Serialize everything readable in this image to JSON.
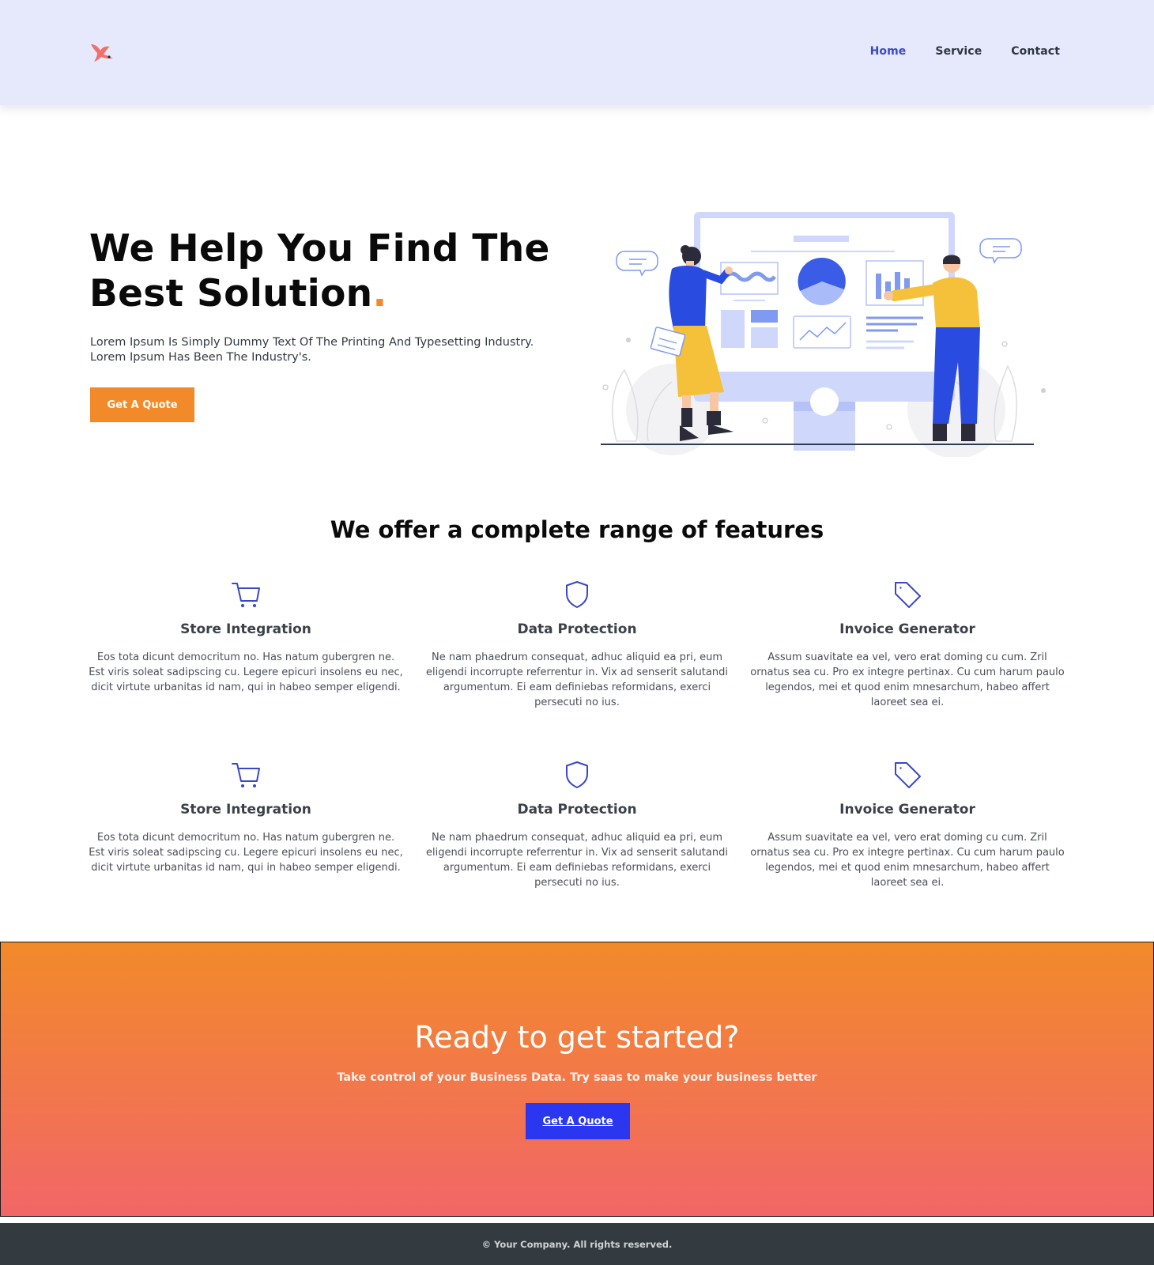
{
  "header": {
    "logo_icon": "bird-logo-icon",
    "nav": [
      {
        "label": "Home",
        "active": true
      },
      {
        "label": "Service",
        "active": false
      },
      {
        "label": "Contact",
        "active": false
      }
    ]
  },
  "hero": {
    "title_line1": "We Help You Find The",
    "title_line2": "Best Solution",
    "title_dot": ".",
    "text_line1": "Lorem Ipsum Is Simply Dummy Text Of The Printing And Typesetting Industry.",
    "text_line2": "Lorem Ipsum Has Been The Industry's.",
    "button_label": "Get A Quote",
    "illustration": "people-analyzing-dashboard-illustration"
  },
  "features": {
    "title": "We offer a complete range of features",
    "items": [
      {
        "icon": "cart-icon",
        "title": "Store Integration",
        "text": "Eos tota dicunt democritum no. Has natum gubergren ne. Est viris soleat sadipscing cu. Legere epicuri insolens eu nec, dicit virtute urbanitas id nam, qui in habeo semper eligendi."
      },
      {
        "icon": "shield-icon",
        "title": "Data Protection",
        "text": "Ne nam phaedrum consequat, adhuc aliquid ea pri, eum eligendi incorrupte referrentur in. Vix ad senserit salutandi argumentum. Ei eam definiebas reformidans, exerci persecuti no ius."
      },
      {
        "icon": "tag-icon",
        "title": "Invoice Generator",
        "text": "Assum suavitate ea vel, vero erat doming cu cum. Zril ornatus sea cu. Pro ex integre pertinax. Cu cum harum paulo legendos, mei et quod enim mnesarchum, habeo affert laoreet sea ei."
      },
      {
        "icon": "cart-icon",
        "title": "Store Integration",
        "text": "Eos tota dicunt democritum no. Has natum gubergren ne. Est viris soleat sadipscing cu. Legere epicuri insolens eu nec, dicit virtute urbanitas id nam, qui in habeo semper eligendi."
      },
      {
        "icon": "shield-icon",
        "title": "Data Protection",
        "text": "Ne nam phaedrum consequat, adhuc aliquid ea pri, eum eligendi incorrupte referrentur in. Vix ad senserit salutandi argumentum. Ei eam definiebas reformidans, exerci persecuti no ius."
      },
      {
        "icon": "tag-icon",
        "title": "Invoice Generator",
        "text": "Assum suavitate ea vel, vero erat doming cu cum. Zril ornatus sea cu. Pro ex integre pertinax. Cu cum harum paulo legendos, mei et quod enim mnesarchum, habeo affert laoreet sea ei."
      }
    ]
  },
  "cta": {
    "title": "Ready to get started?",
    "subtitle": "Take control of your Business Data. Try saas to make your business better",
    "button_label": "Get A Quote"
  },
  "footer": {
    "copyright": "© Your Company. All rights reserved."
  },
  "colors": {
    "header_bg": "#e6e9fb",
    "accent_orange": "#f28a2a",
    "accent_blue": "#2a36ef",
    "nav_active": "#3a48c8",
    "footer_bg": "#343b40"
  }
}
